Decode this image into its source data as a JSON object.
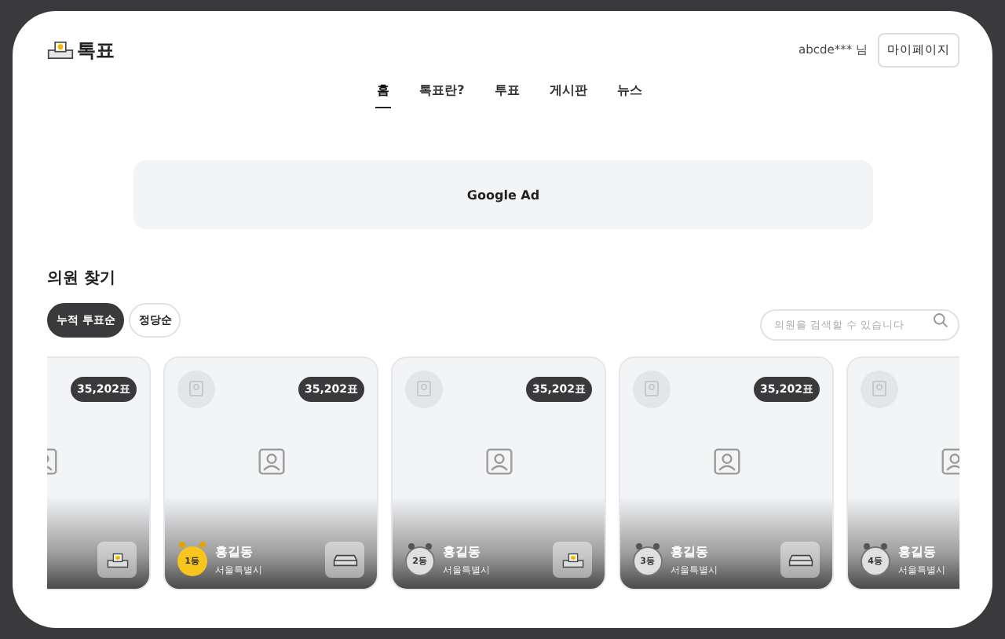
{
  "header": {
    "logo": "톡표",
    "user": "abcde*** 님",
    "mypage_button": "마이페이지"
  },
  "nav": [
    {
      "label": "홈",
      "selected": true
    },
    {
      "label": "톡표란?",
      "selected": false
    },
    {
      "label": "투표",
      "selected": false
    },
    {
      "label": "게시판",
      "selected": false
    },
    {
      "label": "뉴스",
      "selected": false
    }
  ],
  "ad": {
    "label": "Google Ad"
  },
  "section": {
    "title": "의원 찾기"
  },
  "sort_chips": [
    {
      "label": "누적 투표순",
      "selected": true
    },
    {
      "label": "정당순",
      "selected": false
    }
  ],
  "search": {
    "placeholder": "의원을 검색할 수 있습니다"
  },
  "cards": [
    {
      "votes": "35,202표",
      "vote_button": {
        "kind": "ballot"
      }
    },
    {
      "votes": "35,202표",
      "medal": {
        "kind": "gold",
        "rank": "1등"
      },
      "name": "홍길동",
      "region": "서울특별시",
      "vote_button": {
        "kind": "tray"
      }
    },
    {
      "votes": "35,202표",
      "medal": {
        "kind": "silver",
        "rank": "2등"
      },
      "name": "홍길동",
      "region": "서울특별시",
      "vote_button": {
        "kind": "ballot"
      }
    },
    {
      "votes": "35,202표",
      "medal": {
        "kind": "silver",
        "rank": "3등"
      },
      "name": "홍길동",
      "region": "서울특별시",
      "vote_button": {
        "kind": "tray"
      }
    },
    {
      "medal": {
        "kind": "silver",
        "rank": "4등"
      },
      "name": "홍길동",
      "region": "서울특별시"
    }
  ]
}
